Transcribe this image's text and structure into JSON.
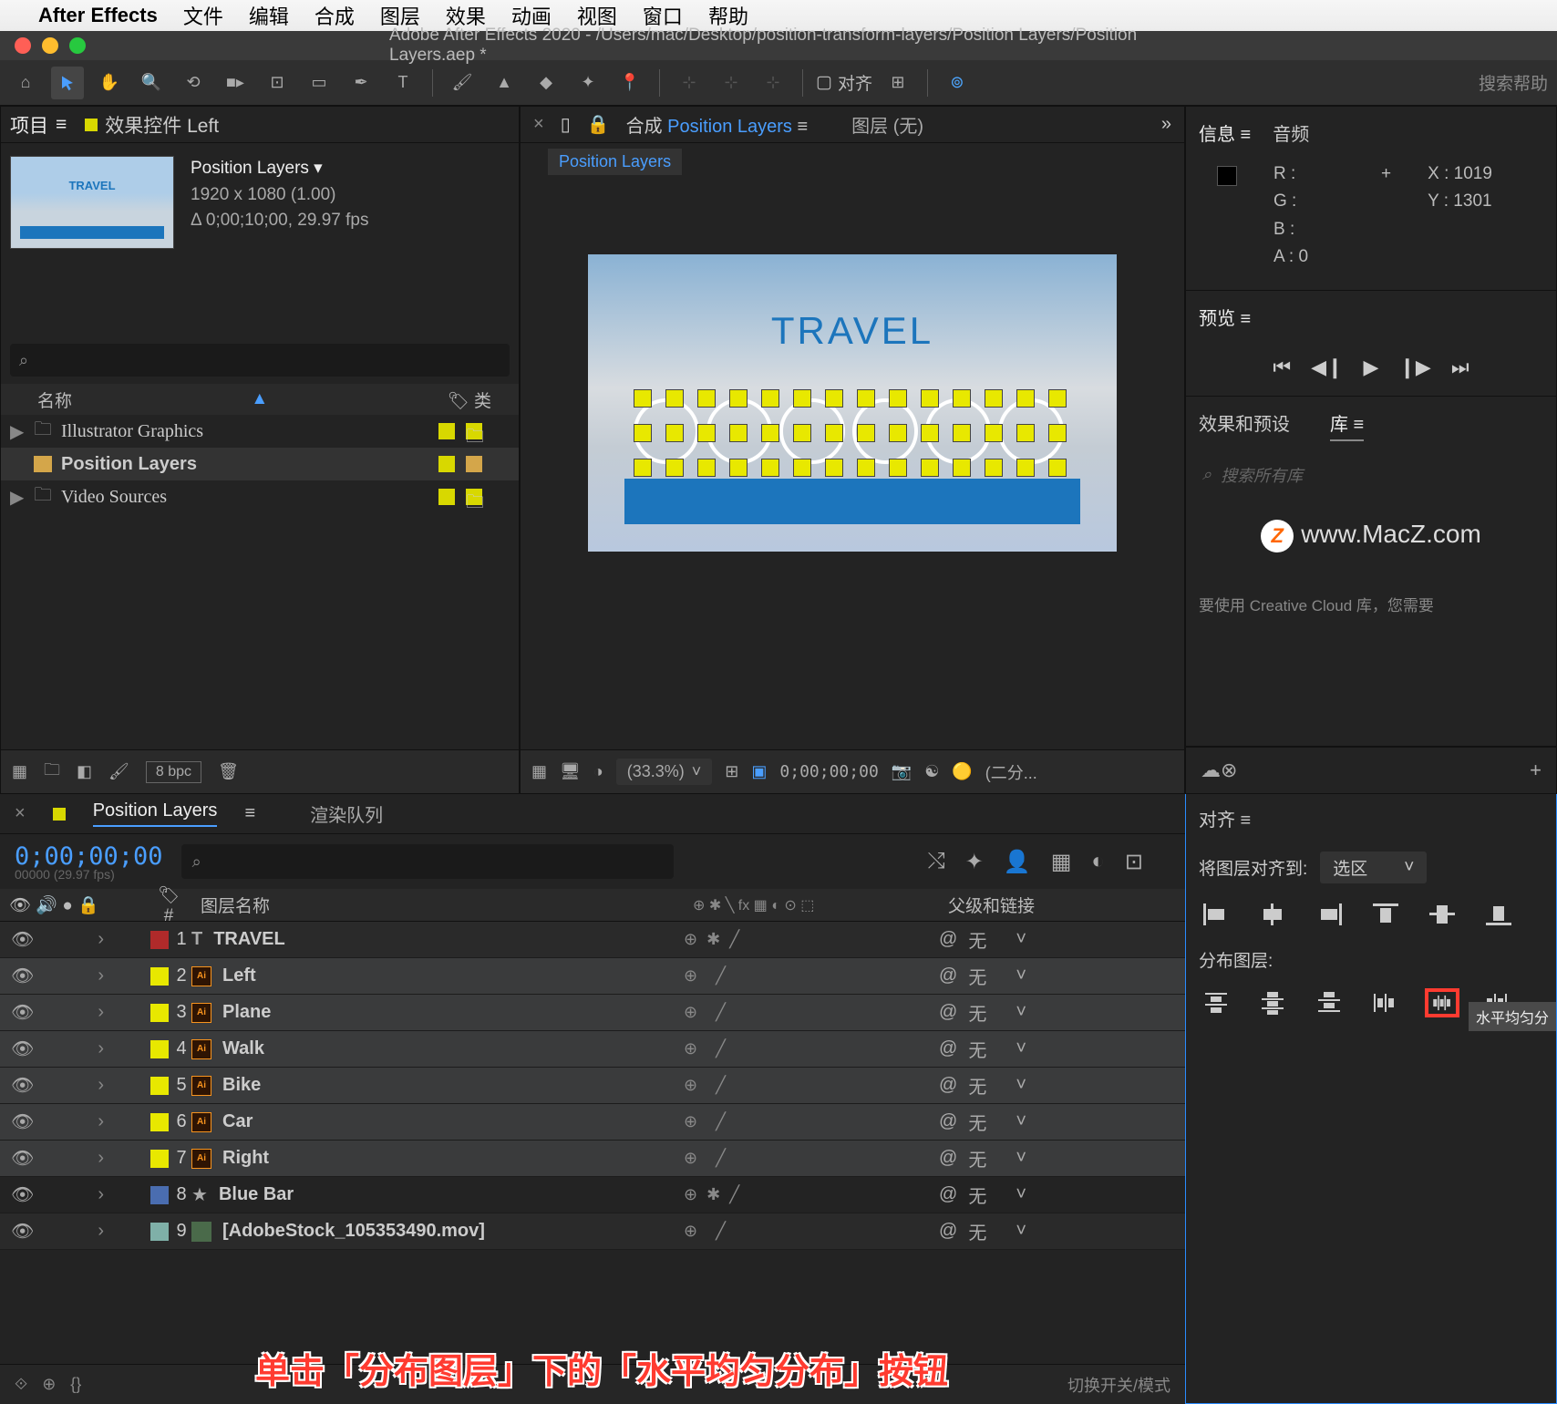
{
  "menubar": {
    "app": "After Effects",
    "items": [
      "文件",
      "编辑",
      "合成",
      "图层",
      "效果",
      "动画",
      "视图",
      "窗口",
      "帮助"
    ]
  },
  "titlebar": {
    "title": "Adobe After Effects 2020 - /Users/mac/Desktop/position-transform-layers/Position Layers/Position Layers.aep *"
  },
  "toolbar": {
    "align_label": "对齐",
    "search_placeholder": "搜索帮助"
  },
  "project": {
    "tab_project": "项目",
    "tab_effects": "效果控件 Left",
    "comp_name": "Position Layers",
    "comp_dim": "1920 x 1080 (1.00)",
    "comp_dur": "Δ 0;00;10;00, 29.97 fps",
    "col_name": "名称",
    "col_type": "类",
    "items": [
      {
        "name": "Illustrator Graphics",
        "type": "folder"
      },
      {
        "name": "Position Layers",
        "type": "comp",
        "selected": true
      },
      {
        "name": "Video Sources",
        "type": "folder"
      }
    ],
    "bpc": "8 bpc"
  },
  "composition": {
    "tab_comp": "合成",
    "tab_comp_name": "Position Layers",
    "tab_layer": "图层  (无)",
    "sub": "Position Layers",
    "canvas_text": "TRAVEL",
    "zoom": "(33.3%)",
    "time": "0;00;00;00",
    "res": "(二分..."
  },
  "info": {
    "tab_info": "信息",
    "tab_audio": "音频",
    "r": "R :",
    "g": "G :",
    "b": "B :",
    "a": "A :  0",
    "x": "X : 1019",
    "y": "Y : 1301"
  },
  "preview": {
    "tab": "预览"
  },
  "effects": {
    "tab_ep": "效果和预设",
    "tab_lib": "库",
    "search": "搜索所有库"
  },
  "watermark": "www.MacZ.com",
  "libfoot": "要使用 Creative Cloud 库，您需要",
  "timeline": {
    "tab_name": "Position Layers",
    "tab_render": "渲染队列",
    "timecode": "0;00;00;00",
    "fps": "00000 (29.97 fps)",
    "col_num": "#",
    "col_name": "图层名称",
    "col_parent": "父级和链接",
    "layers": [
      {
        "n": 1,
        "name": "TRAVEL",
        "icon": "text",
        "color": "#b02a2a",
        "parent": "无"
      },
      {
        "n": 2,
        "name": "Left",
        "icon": "ai",
        "color": "#e8e800",
        "parent": "无",
        "sel": true
      },
      {
        "n": 3,
        "name": "Plane",
        "icon": "ai",
        "color": "#e8e800",
        "parent": "无",
        "sel": true
      },
      {
        "n": 4,
        "name": "Walk",
        "icon": "ai",
        "color": "#e8e800",
        "parent": "无",
        "sel": true
      },
      {
        "n": 5,
        "name": "Bike",
        "icon": "ai",
        "color": "#e8e800",
        "parent": "无",
        "sel": true
      },
      {
        "n": 6,
        "name": "Car",
        "icon": "ai",
        "color": "#e8e800",
        "parent": "无",
        "sel": true
      },
      {
        "n": 7,
        "name": "Right",
        "icon": "ai",
        "color": "#e8e800",
        "parent": "无",
        "sel": true
      },
      {
        "n": 8,
        "name": "Blue Bar",
        "icon": "star",
        "color": "#4a6db0",
        "parent": "无"
      },
      {
        "n": 9,
        "name": "[AdobeStock_105353490.mov]",
        "icon": "mov",
        "color": "#7fb0a8",
        "parent": "无"
      }
    ],
    "toggle": "切换开关/模式"
  },
  "align": {
    "tab": "对齐",
    "to_label": "将图层对齐到:",
    "to_value": "选区",
    "dist_label": "分布图层:",
    "tooltip": "水平均匀分"
  },
  "annotation": "单击「分布图层」下的「水平均匀分布」按钮"
}
